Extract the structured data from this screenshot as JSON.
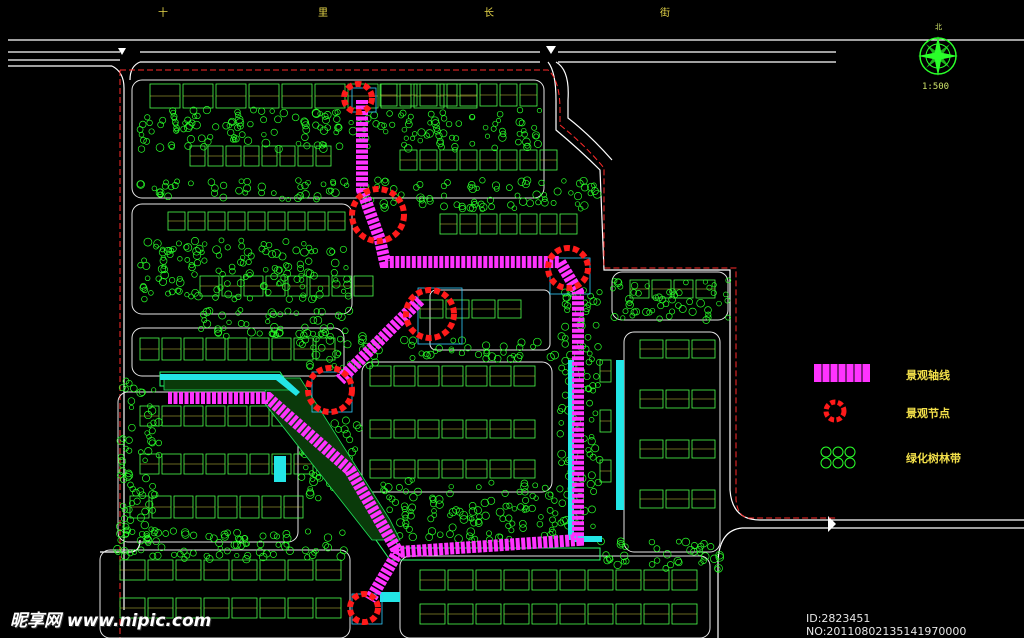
{
  "street_name_chars": [
    "十",
    "里",
    "长",
    "街"
  ],
  "scale_text": "1:500",
  "north_label": "北",
  "legend": {
    "axis": "景观轴线",
    "node": "景观节点",
    "green_belt": "绿化树林带"
  },
  "watermark": {
    "brand": "昵享网 www.nipic.com",
    "id_text": "ID:2823451 NO:20110802135141970000"
  },
  "colors": {
    "background": "#000000",
    "road": "#ffffff",
    "boundary": "#ff2a2a",
    "building": "#4cff4c",
    "tree": "#29ff29",
    "axis": "#ff33ff",
    "node": "#ff1a1a",
    "plaza": "#3cf",
    "water": "#23e6e6",
    "text": "#f3e04a"
  }
}
